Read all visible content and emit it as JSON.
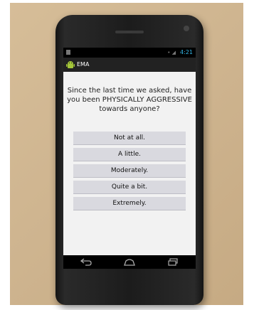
{
  "status_bar": {
    "time": "4:21",
    "icons": "• ◢"
  },
  "action_bar": {
    "app_icon": "android-icon",
    "title": "EMA"
  },
  "survey": {
    "question": "Since the last time we asked, have you been PHYSICALLY AGGRESSIVE towards anyone?",
    "options": [
      "Not at all.",
      "A little.",
      "Moderately.",
      "Quite a bit.",
      "Extremely."
    ]
  },
  "nav_bar": {
    "icons": [
      "back-icon",
      "home-icon",
      "recents-icon"
    ]
  },
  "colors": {
    "background": "#cdb38e",
    "screen_bg": "#f2f2f2",
    "option_bg": "#d9d9df",
    "status_accent": "#33b5e5",
    "action_bar_bg": "#222222"
  }
}
